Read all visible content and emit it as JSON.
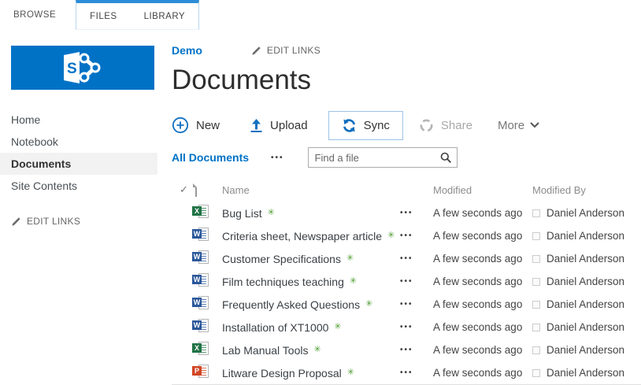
{
  "ribbon": {
    "tabs": [
      {
        "label": "BROWSE"
      },
      {
        "label": "FILES"
      },
      {
        "label": "LIBRARY"
      }
    ]
  },
  "sidebar": {
    "nav_items": [
      {
        "label": "Home",
        "active": false
      },
      {
        "label": "Notebook",
        "active": false
      },
      {
        "label": "Documents",
        "active": true
      },
      {
        "label": "Site Contents",
        "active": false
      }
    ],
    "edit_links_label": "EDIT LINKS"
  },
  "header": {
    "site_link": "Demo",
    "edit_links_label": "EDIT LINKS",
    "page_title": "Documents"
  },
  "toolbar": {
    "new_label": "New",
    "upload_label": "Upload",
    "sync_label": "Sync",
    "share_label": "Share",
    "more_label": "More"
  },
  "view_bar": {
    "current_view": "All Documents",
    "menu_glyph": "•••",
    "search_placeholder": "Find a file"
  },
  "table": {
    "headers": {
      "name": "Name",
      "modified": "Modified",
      "modified_by": "Modified By"
    },
    "select_all_glyph": "✓",
    "row_menu_glyph": "•••",
    "new_badge_glyph": "✳",
    "rows": [
      {
        "type": "excel",
        "name": "Bug List",
        "modified": "A few seconds ago",
        "modified_by": "Daniel Anderson"
      },
      {
        "type": "word",
        "name": "Criteria sheet, Newspaper article",
        "modified": "A few seconds ago",
        "modified_by": "Daniel Anderson"
      },
      {
        "type": "word",
        "name": "Customer Specifications",
        "modified": "A few seconds ago",
        "modified_by": "Daniel Anderson"
      },
      {
        "type": "word",
        "name": "Film techniques teaching",
        "modified": "A few seconds ago",
        "modified_by": "Daniel Anderson"
      },
      {
        "type": "word",
        "name": "Frequently Asked Questions",
        "modified": "A few seconds ago",
        "modified_by": "Daniel Anderson"
      },
      {
        "type": "word",
        "name": "Installation of XT1000",
        "modified": "A few seconds ago",
        "modified_by": "Daniel Anderson"
      },
      {
        "type": "excel",
        "name": "Lab Manual Tools",
        "modified": "A few seconds ago",
        "modified_by": "Daniel Anderson"
      },
      {
        "type": "powerpoint",
        "name": "Litware Design Proposal",
        "modified": "A few seconds ago",
        "modified_by": "Daniel Anderson"
      }
    ]
  },
  "file_type_icons": {
    "excel": {
      "letter": "X",
      "color": "#217346"
    },
    "word": {
      "letter": "W",
      "color": "#2B579A"
    },
    "powerpoint": {
      "letter": "P",
      "color": "#D24726"
    }
  },
  "colors": {
    "accent_blue": "#0072C6",
    "tab_highlight": "#2E8DD8",
    "new_badge_green": "#4E9E31",
    "disabled_gray": "#A8A8A8"
  }
}
